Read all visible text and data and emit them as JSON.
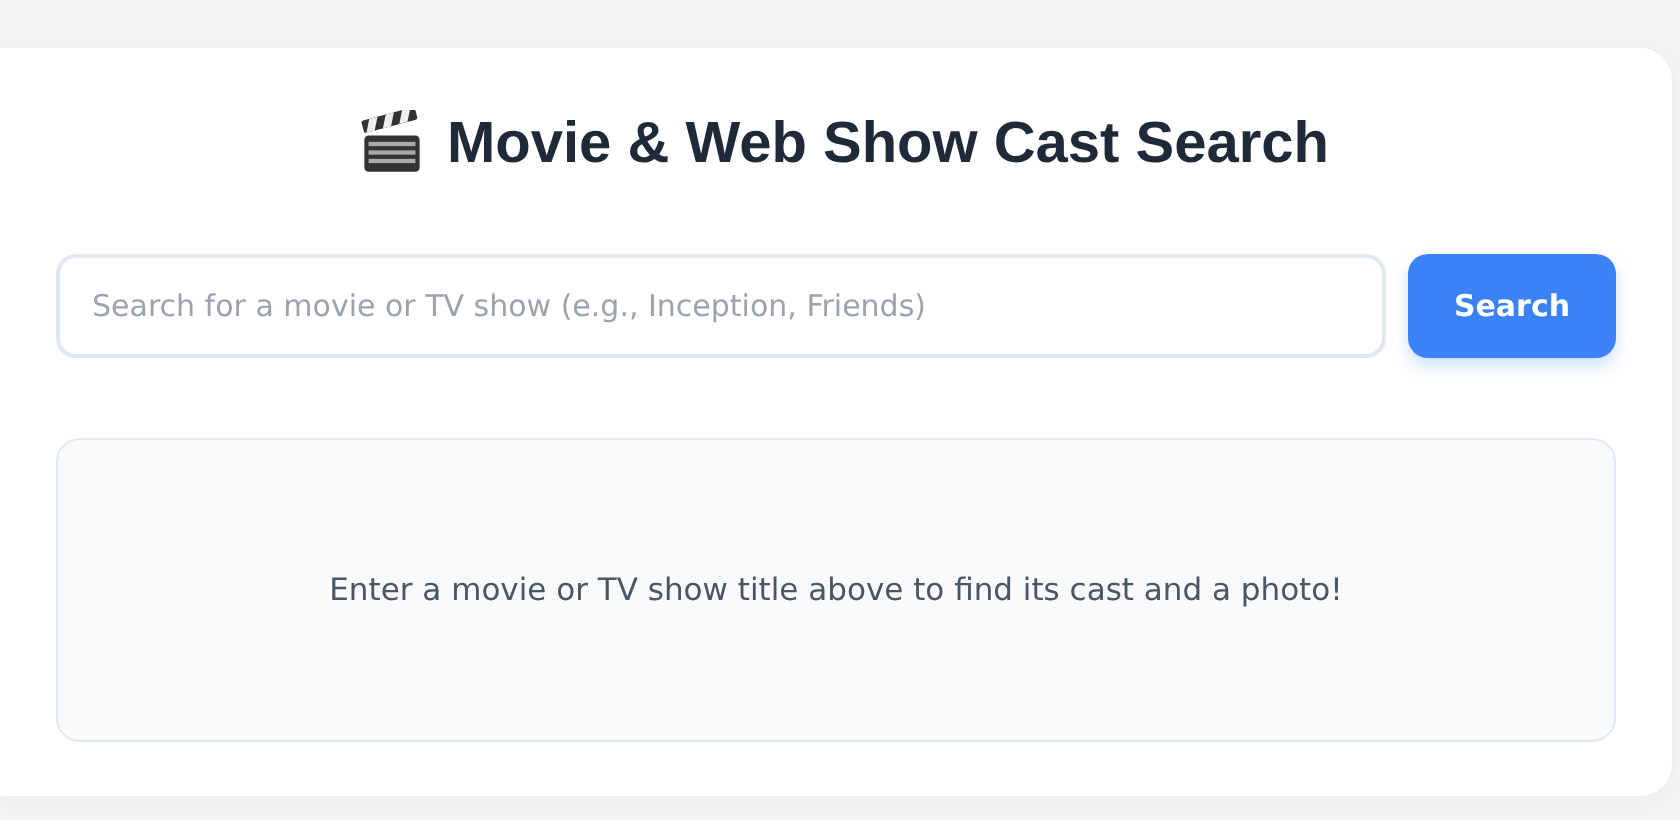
{
  "title": "Movie & Web Show Cast Search",
  "search": {
    "placeholder": "Search for a movie or TV show (e.g., Inception, Friends)"
  },
  "search_button": "Search",
  "results": {
    "message": "Enter a movie or TV show title above to find its cast and a photo!"
  }
}
